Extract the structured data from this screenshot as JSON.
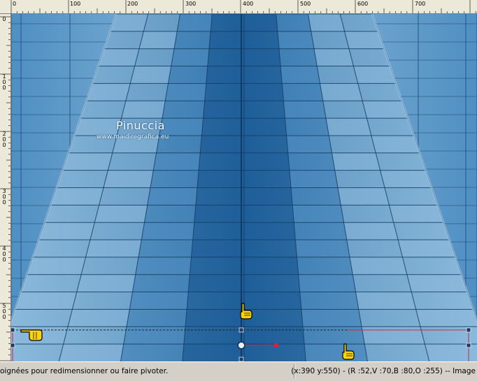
{
  "ruler": {
    "horizontal_labels": [
      "0",
      "100",
      "200",
      "300",
      "400",
      "500",
      "600",
      "700"
    ],
    "vertical_labels": [
      "0",
      "1\n0\n0",
      "2\n0\n0",
      "3\n0\n0",
      "4\n0\n0",
      "5\n0\n0"
    ]
  },
  "watermark": {
    "title": "Pinuccia",
    "url": "www.maidiregrafica.eu"
  },
  "status": {
    "hint": "oignées pour redimensionner ou faire pivoter.",
    "info": "(x:390 y:550) - (R :52,V :70,B :80,O :255) -- Image"
  },
  "colors": {
    "tile_light": "#8dbbdd",
    "tile_mid": "#4f8fc2",
    "tile_dark": "#1f5f99",
    "handle": "#d4243c"
  },
  "icons": {
    "pointer": "pointing-hand-icon",
    "rotate_handle": "rotate-handle-icon"
  }
}
